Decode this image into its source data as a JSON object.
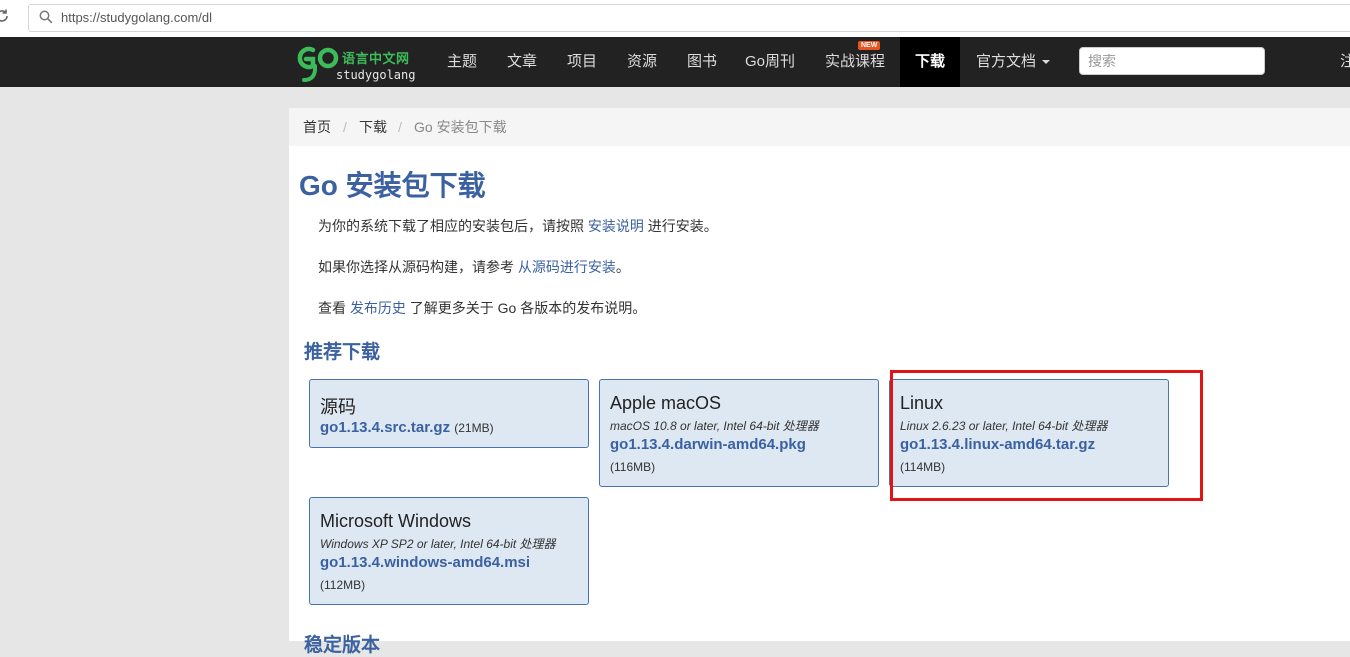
{
  "browser": {
    "url": "https://studygolang.com/dl"
  },
  "nav": {
    "logo_cn": "语言中文网",
    "logo_en": "studygolang",
    "items": [
      {
        "label": "主题"
      },
      {
        "label": "文章"
      },
      {
        "label": "项目"
      },
      {
        "label": "资源"
      },
      {
        "label": "图书"
      },
      {
        "label": "Go周刊"
      },
      {
        "label": "实战课程",
        "badge": "NEW"
      },
      {
        "label": "下载",
        "active": true
      },
      {
        "label": "官方文档"
      }
    ],
    "search_placeholder": "搜索",
    "cut_item": "注"
  },
  "breadcrumb": {
    "home": "首页",
    "sep": "/",
    "download": "下载",
    "current": "Go 安装包下载"
  },
  "page": {
    "title": "Go 安装包下载",
    "para1_pre": "为你的系统下载了相应的安装包后，请按照 ",
    "para1_link": "安装说明",
    "para1_post": " 进行安装。",
    "para2_pre": "如果你选择从源码构建，请参考 ",
    "para2_link": "从源码进行安装",
    "para2_post": "。",
    "para3_pre": "查看 ",
    "para3_link": "发布历史",
    "para3_post": " 了解更多关于 Go 各版本的发布说明。",
    "recommended_title": "推荐下载",
    "stable_title": "稳定版本"
  },
  "downloads": {
    "source": {
      "title": "源码",
      "file": "go1.13.4.src.tar.gz",
      "size": "(21MB)"
    },
    "macos": {
      "title": "Apple macOS",
      "note": "macOS 10.8 or later, Intel 64-bit 处理器",
      "file": "go1.13.4.darwin-amd64.pkg",
      "size": "(116MB)"
    },
    "linux": {
      "title": "Linux",
      "note": "Linux 2.6.23 or later, Intel 64-bit 处理器",
      "file": "go1.13.4.linux-amd64.tar.gz",
      "size": "(114MB)"
    },
    "windows": {
      "title": "Microsoft Windows",
      "note": "Windows XP SP2 or later, Intel 64-bit 处理器",
      "file": "go1.13.4.windows-amd64.msi",
      "size": "(112MB)"
    }
  },
  "colors": {
    "highlight": "#e11515",
    "link": "#3b61a0",
    "nav_bg": "#222222"
  }
}
